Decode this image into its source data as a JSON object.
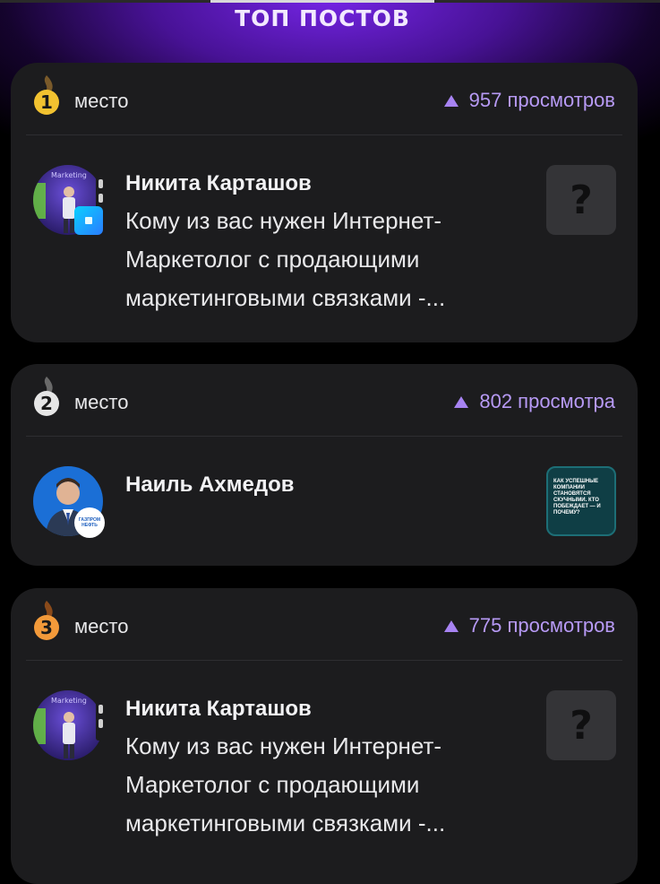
{
  "header": {
    "title": "топ постов"
  },
  "posts": [
    {
      "place": "1",
      "place_label": "место",
      "views": "957 просмотров",
      "author": "Никита Карташов",
      "excerpt": "Кому из вас нужен Интернет-Маркетолог с продающими маркетинговыми связками -...",
      "avatar_text": "Marketing",
      "thumb_text": "?",
      "medal_color": "#f2c230"
    },
    {
      "place": "2",
      "place_label": "место",
      "views": "802 просмотра",
      "author": "Наиль Ахмедов",
      "excerpt": "",
      "avatar_badge": "ГАЗПРОМ НЕФТЬ",
      "thumb_text": "Как успешные компании становятся скучными. Кто побеждает — и почему?",
      "medal_color": "#e6e6e6"
    },
    {
      "place": "3",
      "place_label": "место",
      "views": "775 просмотров",
      "author": "Никита Карташов",
      "excerpt": "Кому из вас нужен Интернет-Маркетолог с продающими маркетинговыми связками -...",
      "avatar_text": "Marketing",
      "thumb_text": "?",
      "medal_color": "#f39a3a"
    }
  ],
  "colors": {
    "background": "#000000",
    "card": "#1c1c1e",
    "accent": "#b79af5",
    "glow": "#7a26f0"
  }
}
